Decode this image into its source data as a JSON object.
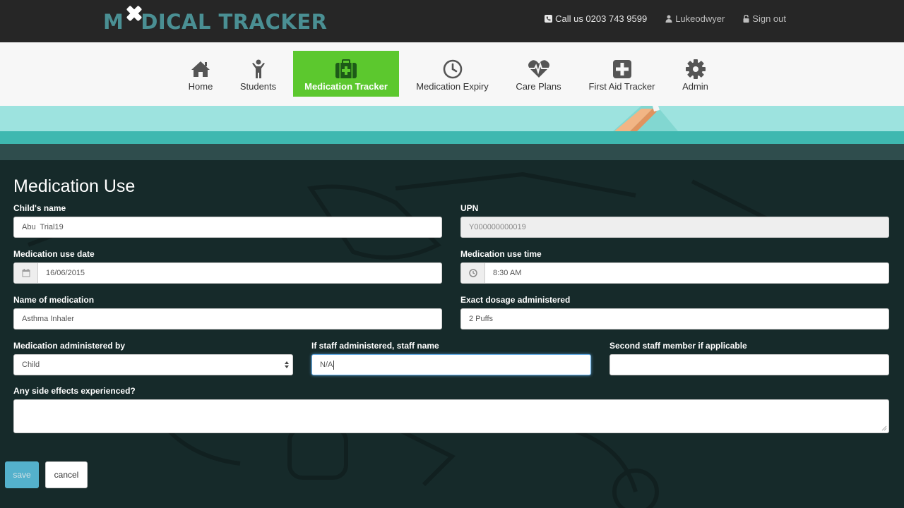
{
  "header": {
    "logo_pre": "M",
    "logo_post": "DICAL TRACKER",
    "phone": "Call us 0203 743 9599",
    "username": "Lukeodwyer",
    "signout": "Sign out"
  },
  "nav": {
    "items": [
      {
        "label": "Home",
        "icon": "home-icon"
      },
      {
        "label": "Students",
        "icon": "person-icon"
      },
      {
        "label": "Medication Tracker",
        "icon": "medical-bag-icon"
      },
      {
        "label": "Medication Expiry",
        "icon": "clock-icon"
      },
      {
        "label": "Care Plans",
        "icon": "heartbeat-icon"
      },
      {
        "label": "First Aid Tracker",
        "icon": "plus-square-icon"
      },
      {
        "label": "Admin",
        "icon": "gear-icon"
      }
    ],
    "active": "Medication Tracker"
  },
  "form": {
    "title": "Medication Use",
    "child_name": {
      "label": "Child's name",
      "value": "Abu  Trial19"
    },
    "upn": {
      "label": "UPN",
      "value": "Y000000000019"
    },
    "use_date": {
      "label": "Medication use date",
      "value": "16/06/2015"
    },
    "use_time": {
      "label": "Medication use time",
      "value": "8:30 AM"
    },
    "medication_name": {
      "label": "Name of medication",
      "value": "Asthma Inhaler"
    },
    "dosage": {
      "label": "Exact dosage administered",
      "value": "2 Puffs"
    },
    "administered_by": {
      "label": "Medication administered by",
      "value": "Child"
    },
    "staff_name": {
      "label": "If staff administered, staff name",
      "value": "N/A"
    },
    "second_staff": {
      "label": "Second staff member if applicable",
      "value": ""
    },
    "side_effects": {
      "label": "Any side effects experienced?",
      "value": ""
    },
    "save_label": "save",
    "cancel_label": "cancel"
  },
  "colors": {
    "nav_active": "#5cc82e",
    "logo": "#4a8f93",
    "topbar": "#262626",
    "save_button": "#5bc0de"
  }
}
